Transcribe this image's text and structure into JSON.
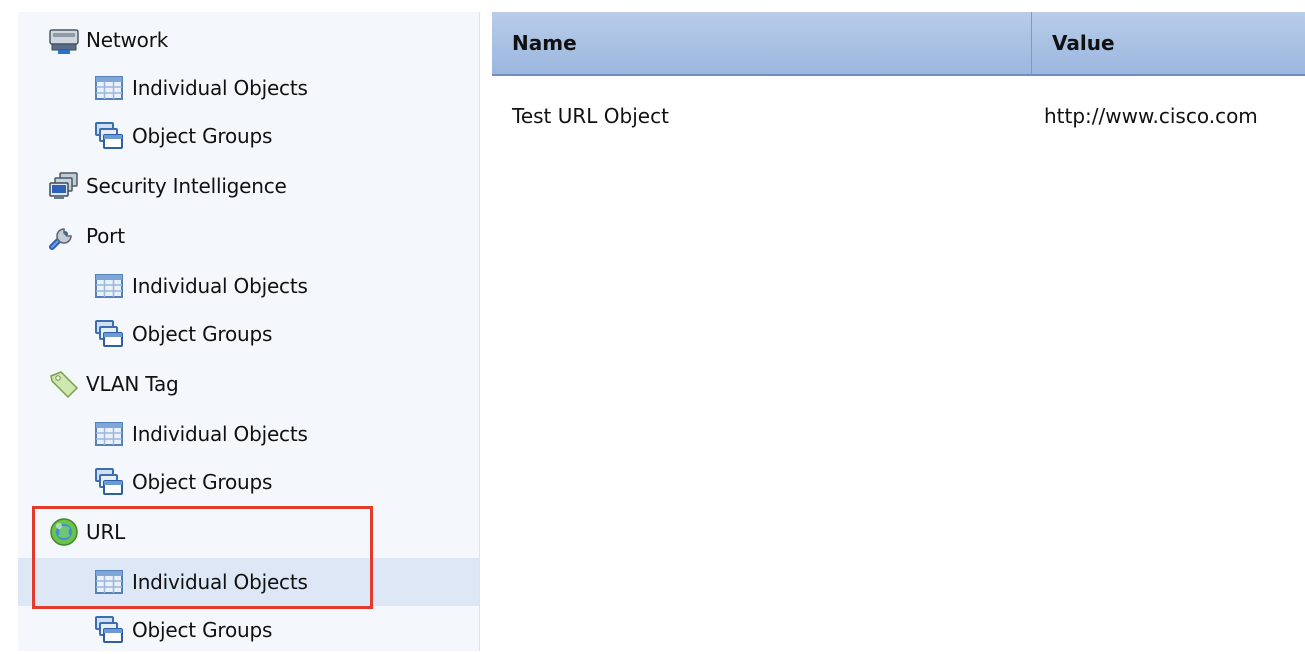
{
  "sidebar": {
    "items": [
      {
        "label": "Network",
        "icon": "network-icon"
      },
      {
        "label": "Individual Objects",
        "icon": "table-icon"
      },
      {
        "label": "Object Groups",
        "icon": "object-groups-icon"
      },
      {
        "label": "Security Intelligence",
        "icon": "security-intelligence-icon"
      },
      {
        "label": "Port",
        "icon": "wrench-icon"
      },
      {
        "label": "Individual Objects",
        "icon": "table-icon"
      },
      {
        "label": "Object Groups",
        "icon": "object-groups-icon"
      },
      {
        "label": "VLAN Tag",
        "icon": "tag-icon"
      },
      {
        "label": "Individual Objects",
        "icon": "table-icon"
      },
      {
        "label": "Object Groups",
        "icon": "object-groups-icon"
      },
      {
        "label": "URL",
        "icon": "globe-icon"
      },
      {
        "label": "Individual Objects",
        "icon": "table-icon",
        "selected": true
      },
      {
        "label": "Object Groups",
        "icon": "object-groups-icon"
      }
    ]
  },
  "table": {
    "columns": [
      "Name",
      "Value"
    ],
    "rows": [
      {
        "name": "Test URL Object",
        "value": "http://www.cisco.com"
      }
    ]
  },
  "colors": {
    "highlight_border": "#e23b2e",
    "selected_row": "#dde7f5",
    "header_bg": "#a7bfe2"
  }
}
